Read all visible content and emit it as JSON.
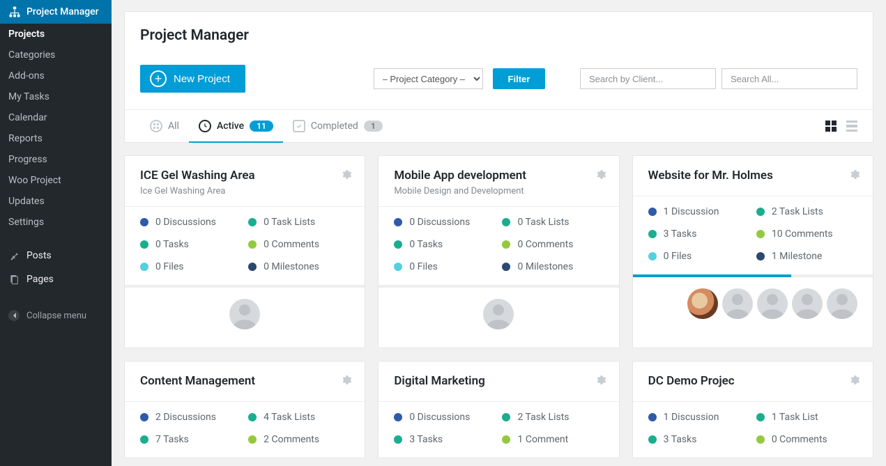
{
  "sidebar": {
    "main": "Project Manager",
    "items": [
      {
        "label": "Projects",
        "active": true
      },
      {
        "label": "Categories"
      },
      {
        "label": "Add-ons"
      },
      {
        "label": "My Tasks"
      },
      {
        "label": "Calendar"
      },
      {
        "label": "Reports"
      },
      {
        "label": "Progress"
      },
      {
        "label": "Woo Project"
      },
      {
        "label": "Updates"
      },
      {
        "label": "Settings"
      }
    ],
    "others": {
      "posts": "Posts",
      "pages": "Pages"
    },
    "collapse": "Collapse menu"
  },
  "header": {
    "title": "Project Manager"
  },
  "toolbar": {
    "new_label": "New Project",
    "category_select": "– Project Category –",
    "filter_label": "Filter",
    "search_client_ph": "Search by Client...",
    "search_all_ph": "Search All..."
  },
  "tabs": {
    "all": "All",
    "active": {
      "label": "Active",
      "count": "11"
    },
    "completed": {
      "label": "Completed",
      "count": "1"
    }
  },
  "projects": [
    {
      "title": "ICE Gel Washing Area",
      "sub": "Ice Gel Washing Area",
      "stats": {
        "discussions": "0 Discussions",
        "task_lists": "0 Task Lists",
        "tasks": "0 Tasks",
        "comments": "0 Comments",
        "files": "0 Files",
        "milestones": "0 Milestones"
      },
      "progress": 0,
      "avatars": [
        "blank"
      ],
      "foot": "center"
    },
    {
      "title": "Mobile App development",
      "sub": "Mobile Design and Development",
      "stats": {
        "discussions": "0 Discussions",
        "task_lists": "0 Task Lists",
        "tasks": "0 Tasks",
        "comments": "0 Comments",
        "files": "0 Files",
        "milestones": "0 Milestones"
      },
      "progress": 0,
      "avatars": [
        "blank"
      ],
      "foot": "center"
    },
    {
      "title": "Website for Mr. Holmes",
      "sub": "",
      "stats": {
        "discussions": "1 Discussion",
        "task_lists": "2 Task Lists",
        "tasks": "3 Tasks",
        "comments": "10 Comments",
        "files": "0 Files",
        "milestones": "1 Milestone"
      },
      "progress": 66,
      "avatars": [
        "photo",
        "blank",
        "blank",
        "blank",
        "blank"
      ],
      "foot": "right"
    },
    {
      "title": "Content Management",
      "sub": "",
      "stats": {
        "discussions": "2 Discussions",
        "task_lists": "4 Task Lists",
        "tasks": "7 Tasks",
        "comments": "2 Comments"
      },
      "progress": null
    },
    {
      "title": "Digital Marketing",
      "sub": "",
      "stats": {
        "discussions": "0 Discussions",
        "task_lists": "2 Task Lists",
        "tasks": "3 Tasks",
        "comments": "1 Comment"
      },
      "progress": null
    },
    {
      "title": "DC Demo Projec",
      "sub": "",
      "stats": {
        "discussions": "1 Discussion",
        "task_lists": "1 Task List",
        "tasks": "3 Tasks",
        "comments": "0 Comments"
      },
      "progress": null
    }
  ]
}
